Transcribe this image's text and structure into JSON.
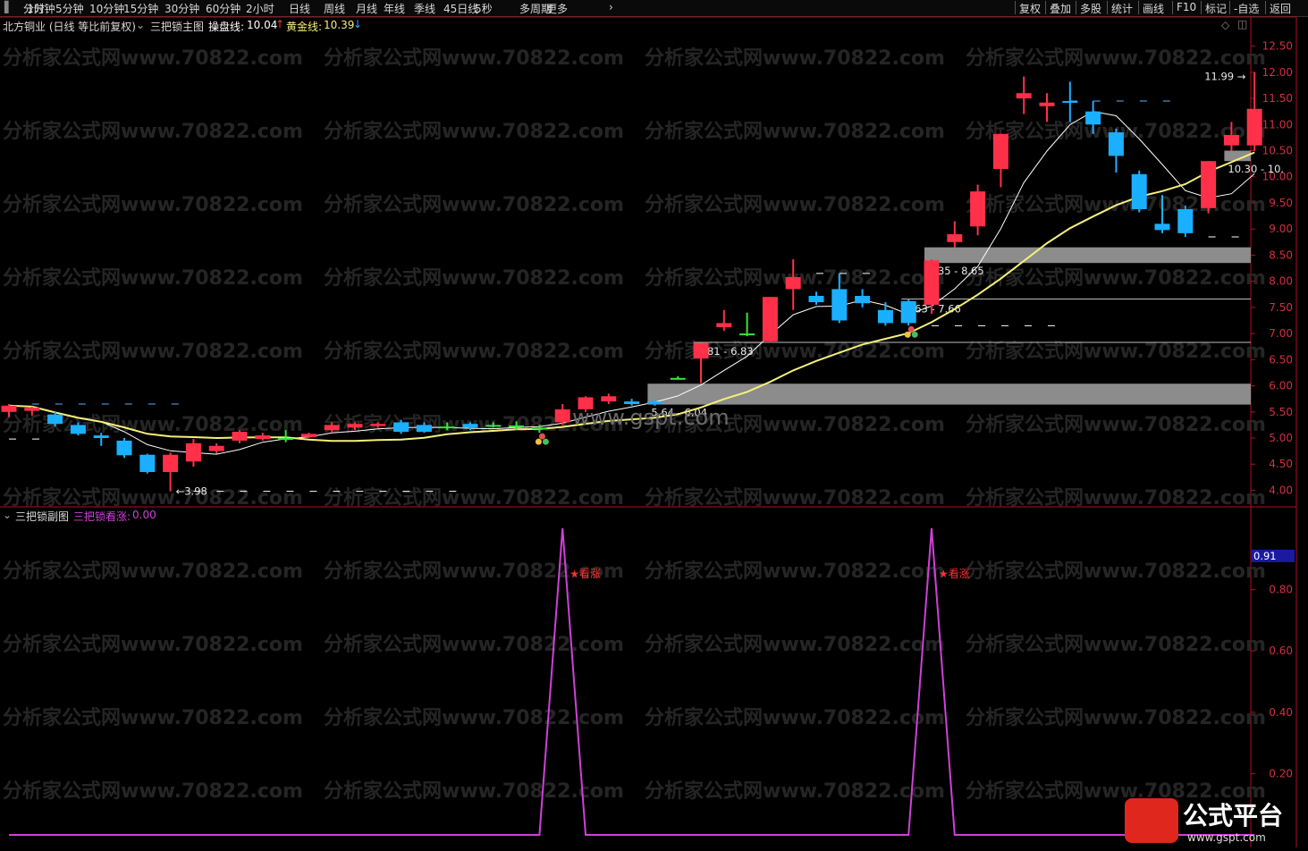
{
  "toolbar": {
    "periods": [
      "分时",
      "1分钟",
      "5分钟",
      "10分钟",
      "15分钟",
      "30分钟",
      "60分钟",
      "2小时",
      "日线",
      "周线",
      "月线",
      "年线",
      "季线",
      "45日线",
      "5秒",
      "多周期",
      "更多"
    ],
    "right_buttons": [
      "复权",
      "叠加",
      "多股",
      "统计",
      "画线",
      "F10",
      "标记",
      "-自选",
      "返回"
    ]
  },
  "main_header": {
    "security": "北方铜业 (日线 等比前复权)",
    "indicator": "三把锁主图",
    "line1_label": "操盘线:",
    "line1_value": "10.04",
    "line1_arrow": "↑",
    "line2_label": "黄金线:",
    "line2_value": "10.39",
    "line2_arrow": "↓"
  },
  "sub_header": {
    "indicator": "三把锁副图",
    "series_label": "三把锁看涨:",
    "series_value": "0.00"
  },
  "watermark": {
    "repeat_text": "分析家公式网www.70822.com",
    "center_text": "www.gspt.com",
    "logo_text": "公式平台",
    "logo_url": "www.gspt.com"
  },
  "chart_data": [
    {
      "type": "candlestick",
      "y_axis_ticks": [
        "12.50",
        "12.00",
        "11.50",
        "11.00",
        "10.50",
        "10.00",
        "9.50",
        "9.00",
        "8.50",
        "8.00",
        "7.50",
        "7.00",
        "6.50",
        "6.00",
        "5.50",
        "5.00",
        "4.50",
        "4.00"
      ],
      "ylim": [
        3.7,
        12.75
      ],
      "colors": {
        "up": "#ff3048",
        "down": "#1ab0ff",
        "doji": "#39e639",
        "operating_line": "#ffffff",
        "golden_line": "#f5f07a",
        "zone": "#8c8c8c"
      },
      "candles": [
        {
          "o": 5.5,
          "h": 5.65,
          "l": 5.4,
          "c": 5.62
        },
        {
          "o": 5.52,
          "h": 5.6,
          "l": 5.43,
          "c": 5.58
        },
        {
          "o": 5.45,
          "h": 5.5,
          "l": 5.22,
          "c": 5.27
        },
        {
          "o": 5.25,
          "h": 5.3,
          "l": 5.05,
          "c": 5.08
        },
        {
          "o": 5.05,
          "h": 5.1,
          "l": 4.85,
          "c": 5.0
        },
        {
          "o": 4.95,
          "h": 5.0,
          "l": 4.62,
          "c": 4.67
        },
        {
          "o": 4.68,
          "h": 4.7,
          "l": 4.32,
          "c": 4.35
        },
        {
          "o": 4.35,
          "h": 4.72,
          "l": 3.98,
          "c": 4.68
        },
        {
          "o": 4.55,
          "h": 4.98,
          "l": 4.45,
          "c": 4.9
        },
        {
          "o": 4.75,
          "h": 4.9,
          "l": 4.7,
          "c": 4.85
        },
        {
          "o": 4.95,
          "h": 5.15,
          "l": 4.9,
          "c": 5.12
        },
        {
          "o": 4.98,
          "h": 5.1,
          "l": 4.95,
          "c": 5.05
        },
        {
          "o": 5.0,
          "h": 5.15,
          "l": 4.92,
          "c": 5.0
        },
        {
          "o": 5.02,
          "h": 5.1,
          "l": 5.0,
          "c": 5.08
        },
        {
          "o": 5.15,
          "h": 5.3,
          "l": 5.1,
          "c": 5.25
        },
        {
          "o": 5.2,
          "h": 5.3,
          "l": 5.15,
          "c": 5.27
        },
        {
          "o": 5.23,
          "h": 5.3,
          "l": 5.2,
          "c": 5.27
        },
        {
          "o": 5.3,
          "h": 5.35,
          "l": 5.08,
          "c": 5.12
        },
        {
          "o": 5.25,
          "h": 5.3,
          "l": 5.1,
          "c": 5.12
        },
        {
          "o": 5.22,
          "h": 5.3,
          "l": 5.15,
          "c": 5.22
        },
        {
          "o": 5.27,
          "h": 5.3,
          "l": 5.15,
          "c": 5.2
        },
        {
          "o": 5.25,
          "h": 5.3,
          "l": 5.2,
          "c": 5.23
        },
        {
          "o": 5.24,
          "h": 5.32,
          "l": 5.15,
          "c": 5.24
        },
        {
          "o": 5.2,
          "h": 5.25,
          "l": 5.1,
          "c": 5.2
        },
        {
          "o": 5.3,
          "h": 5.65,
          "l": 5.25,
          "c": 5.55
        },
        {
          "o": 5.55,
          "h": 5.8,
          "l": 5.5,
          "c": 5.78
        },
        {
          "o": 5.7,
          "h": 5.85,
          "l": 5.65,
          "c": 5.8
        },
        {
          "o": 5.7,
          "h": 5.75,
          "l": 5.62,
          "c": 5.65
        },
        {
          "o": 5.7,
          "h": 5.75,
          "l": 5.62,
          "c": 5.65
        },
        {
          "o": 6.15,
          "h": 6.18,
          "l": 6.12,
          "c": 6.15
        },
        {
          "o": 6.52,
          "h": 6.82,
          "l": 6.05,
          "c": 6.82
        },
        {
          "o": 7.12,
          "h": 7.45,
          "l": 7.05,
          "c": 7.2
        },
        {
          "o": 7.0,
          "h": 7.4,
          "l": 6.95,
          "c": 7.0
        },
        {
          "o": 6.85,
          "h": 7.7,
          "l": 6.82,
          "c": 7.7
        },
        {
          "o": 7.85,
          "h": 8.42,
          "l": 7.45,
          "c": 8.08
        },
        {
          "o": 7.72,
          "h": 7.8,
          "l": 7.55,
          "c": 7.6
        },
        {
          "o": 7.85,
          "h": 8.15,
          "l": 7.2,
          "c": 7.25
        },
        {
          "o": 7.72,
          "h": 7.85,
          "l": 7.5,
          "c": 7.58
        },
        {
          "o": 7.45,
          "h": 7.6,
          "l": 7.15,
          "c": 7.2
        },
        {
          "o": 7.62,
          "h": 7.65,
          "l": 7.15,
          "c": 7.2
        },
        {
          "o": 7.55,
          "h": 8.42,
          "l": 7.38,
          "c": 8.4
        },
        {
          "o": 8.75,
          "h": 9.15,
          "l": 8.65,
          "c": 8.9
        },
        {
          "o": 9.05,
          "h": 9.85,
          "l": 8.88,
          "c": 9.72
        },
        {
          "o": 10.15,
          "h": 10.82,
          "l": 9.8,
          "c": 10.82
        },
        {
          "o": 11.5,
          "h": 11.92,
          "l": 11.2,
          "c": 11.6
        },
        {
          "o": 11.35,
          "h": 11.6,
          "l": 11.05,
          "c": 11.42
        },
        {
          "o": 11.45,
          "h": 11.82,
          "l": 11.05,
          "c": 11.42
        },
        {
          "o": 11.25,
          "h": 11.45,
          "l": 10.82,
          "c": 11.0
        },
        {
          "o": 10.85,
          "h": 10.92,
          "l": 10.08,
          "c": 10.4
        },
        {
          "o": 10.05,
          "h": 10.12,
          "l": 9.32,
          "c": 9.38
        },
        {
          "o": 9.1,
          "h": 9.65,
          "l": 8.92,
          "c": 8.98
        },
        {
          "o": 9.38,
          "h": 9.45,
          "l": 8.85,
          "c": 8.92
        },
        {
          "o": 9.4,
          "h": 10.3,
          "l": 9.3,
          "c": 10.3
        },
        {
          "o": 10.6,
          "h": 11.05,
          "l": 10.5,
          "c": 10.8
        },
        {
          "o": 10.6,
          "h": 12.0,
          "l": 10.5,
          "c": 11.3
        }
      ],
      "zones": [
        {
          "low": 5.64,
          "high": 6.04,
          "label": "5.64 - 6.04",
          "start_index": 28
        },
        {
          "low": 6.81,
          "high": 6.83,
          "label": "6.81 - 6.83",
          "start_index": 30
        },
        {
          "low": 7.63,
          "high": 7.66,
          "label": "7.63 - 7.66",
          "start_index": 39
        },
        {
          "low": 8.35,
          "high": 8.65,
          "label": "8.35 - 8.65",
          "start_index": 40
        },
        {
          "low": 10.3,
          "high": 10.5,
          "label": "10.30 - 10.",
          "start_index": 53
        }
      ],
      "annotations": [
        {
          "price": 3.98,
          "label": "3.98",
          "index": 7
        },
        {
          "price": 11.99,
          "label": "11.99",
          "index": 54
        }
      ],
      "dashed_levels": [
        {
          "price": 5.65,
          "from": 1,
          "to": 8,
          "color": "#49b5ff"
        },
        {
          "price": 4.98,
          "from": 0,
          "to": 2,
          "color": "#ffffff"
        },
        {
          "price": 3.98,
          "from": 8,
          "to": 20,
          "color": "#ffffff"
        },
        {
          "price": 8.15,
          "from": 35,
          "to": 38,
          "color": "#ffffff"
        },
        {
          "price": 7.15,
          "from": 40,
          "to": 46,
          "color": "#ffffff"
        },
        {
          "price": 11.45,
          "from": 46,
          "to": 51,
          "color": "#49b5ff"
        },
        {
          "price": 8.85,
          "from": 52,
          "to": 54,
          "color": "#ffffff"
        }
      ],
      "signal_markers": [
        23,
        39
      ]
    },
    {
      "type": "line",
      "series": [
        {
          "name": "三把锁看涨",
          "values": [
            0,
            0,
            0,
            0,
            0,
            0,
            0,
            0,
            0,
            0,
            0,
            0,
            0,
            0,
            0,
            0,
            0,
            0,
            0,
            0,
            0,
            0,
            0,
            0,
            1,
            0,
            0,
            0,
            0,
            0,
            0,
            0,
            0,
            0,
            0,
            0,
            0,
            0,
            0,
            0,
            1,
            0,
            0,
            0,
            0,
            0,
            0,
            0,
            0,
            0,
            0,
            0,
            0,
            0,
            0
          ]
        }
      ],
      "y_axis_ticks": [
        "0.91",
        "0.80",
        "0.60",
        "0.40",
        "0.20"
      ],
      "ylim": [
        0,
        1
      ],
      "annotations": [
        {
          "index": 24,
          "label": "★看涨"
        },
        {
          "index": 40,
          "label": "★看涨"
        }
      ],
      "color": "#d040d8"
    }
  ]
}
